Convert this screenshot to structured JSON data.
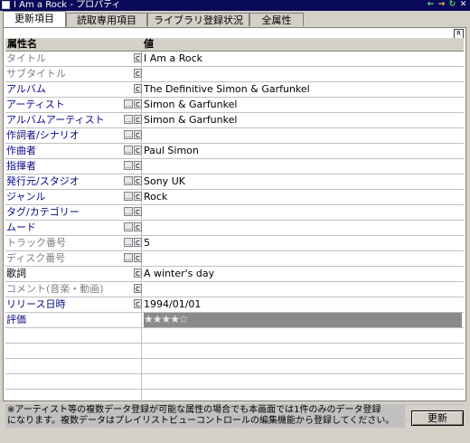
{
  "window": {
    "title": "I  Am a Rock  -  プロパティ",
    "controls": [
      "←",
      "→",
      "↻",
      "✕"
    ]
  },
  "tabs": [
    "更新項目",
    "読取専用項目",
    "ライブラリ登録状況",
    "全属性"
  ],
  "corner_button": "R",
  "grid": {
    "headers": [
      "属性名",
      "値"
    ],
    "rows": [
      {
        "name": "タイトル",
        "value": "I Am a Rock",
        "style": "gray",
        "dots": false,
        "c": true
      },
      {
        "name": "サブタイトル",
        "value": "",
        "style": "gray",
        "dots": false,
        "c": true
      },
      {
        "name": "アルバム",
        "value": "The Definitive Simon & Garfunkel",
        "style": "blue",
        "dots": false,
        "c": true
      },
      {
        "name": "アーティスト",
        "value": "Simon & Garfunkel",
        "style": "blue",
        "dots": true,
        "c": true
      },
      {
        "name": "アルバムアーティスト",
        "value": "Simon & Garfunkel",
        "style": "blue",
        "dots": true,
        "c": true
      },
      {
        "name": "作詞者/シナリオ",
        "value": "",
        "style": "blue",
        "dots": true,
        "c": true
      },
      {
        "name": "作曲者",
        "value": "Paul Simon",
        "style": "blue",
        "dots": true,
        "c": true
      },
      {
        "name": "指揮者",
        "value": "",
        "style": "blue",
        "dots": true,
        "c": true
      },
      {
        "name": "発行元/スタジオ",
        "value": "Sony UK",
        "style": "blue",
        "dots": true,
        "c": true
      },
      {
        "name": "ジャンル",
        "value": "Rock",
        "style": "blue",
        "dots": true,
        "c": true
      },
      {
        "name": "タグ/カテゴリー",
        "value": "",
        "style": "blue",
        "dots": true,
        "c": true
      },
      {
        "name": "ムード",
        "value": "",
        "style": "blue",
        "dots": true,
        "c": true
      },
      {
        "name": "トラック番号",
        "value": "5",
        "style": "gray",
        "dots": true,
        "c": true
      },
      {
        "name": "ディスク番号",
        "value": "",
        "style": "gray",
        "dots": true,
        "c": true
      },
      {
        "name": "歌詞",
        "value": "A winter's day",
        "style": "black",
        "dots": false,
        "c": true
      },
      {
        "name": "コメント(音楽・動画)",
        "value": "",
        "style": "gray",
        "dots": false,
        "c": true
      },
      {
        "name": "リリース日時",
        "value": "1994/01/01",
        "style": "blue",
        "dots": false,
        "c": true
      },
      {
        "name": "評価",
        "value": "★★★★☆",
        "style": "blue",
        "dots": false,
        "c": false,
        "rating": true
      }
    ],
    "empty_rows": 6
  },
  "footer": {
    "note_line1": "※アーティスト等の複数データ登録が可能な属性の場合でも本画面では1件のみのデータ登録",
    "note_line2": "になります。複数データはプレイリストビューコントロールの編集機能から登録してください。",
    "update_button": "更新"
  },
  "colors": {
    "titlebar": "#0a0a5a",
    "label_blue": "#0a0a8a",
    "label_gray": "#808080",
    "rating_bg": "#8a8a8a"
  }
}
